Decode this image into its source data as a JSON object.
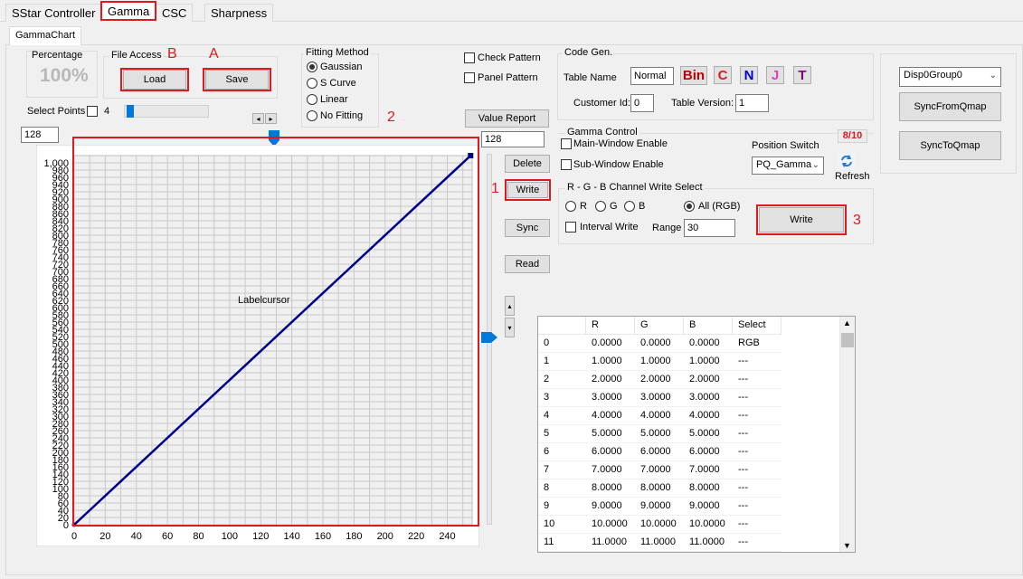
{
  "tabs": [
    "SStar Controller",
    "Gamma",
    "CSC",
    "Sharpness"
  ],
  "subtab": "GammaChart",
  "percentage": {
    "label": "Percentage",
    "value": "100%"
  },
  "file_access": {
    "label": "File Access",
    "load": "Load",
    "save": "Save"
  },
  "annotations": {
    "A": "A",
    "B": "B",
    "n1": "1",
    "n2": "2",
    "n3": "3"
  },
  "fitting": {
    "label": "Fitting Method",
    "options": [
      "Gaussian",
      "S Curve",
      "Linear",
      "No Fitting"
    ],
    "selected": "Gaussian"
  },
  "select_points": {
    "label": "Select Points",
    "value": "4",
    "checked": false
  },
  "x_value": "128",
  "y_value": "128",
  "check_pattern": "Check Pattern",
  "panel_pattern": "Panel Pattern",
  "buttons": {
    "value_report": "Value Report",
    "delete": "Delete",
    "write": "Write",
    "sync": "Sync",
    "read": "Read",
    "up": "▴",
    "down": "▾",
    "left": "◂",
    "right": "▸"
  },
  "code_gen": {
    "label": "Code Gen.",
    "table_name_label": "Table Name",
    "table_name": "Normal",
    "bin": "Bin",
    "c": "C",
    "n": "N",
    "j": "J",
    "t": "T",
    "customer_label": "Customer Id:",
    "customer_id": "0",
    "version_label": "Table Version:",
    "version": "1"
  },
  "gamma_control": {
    "label": "Gamma Control",
    "main_window": "Main-Window Enable",
    "sub_window": "Sub-Window Enable",
    "position_switch": "Position Switch",
    "position_value": "PQ_Gamma",
    "count": "8/10",
    "refresh": "Refresh"
  },
  "rgb_write": {
    "label": "R - G - B Channel Write Select",
    "r": "R",
    "g": "G",
    "b": "B",
    "all": "All (RGB)",
    "interval": "Interval Write",
    "range_label": "Range",
    "range": "30",
    "write": "Write"
  },
  "disp": {
    "group": "Disp0Group0",
    "sync_from": "SyncFromQmap",
    "sync_to": "SyncToQmap"
  },
  "chart_cursor_label": "Labelcursor",
  "colors": {
    "red": "#e0191e",
    "line": "#00008b",
    "accent": "#0078d7"
  },
  "table": {
    "headers": [
      "",
      "R",
      "G",
      "B",
      "Select"
    ],
    "rows": [
      [
        "0",
        "0.0000",
        "0.0000",
        "0.0000",
        "RGB"
      ],
      [
        "1",
        "1.0000",
        "1.0000",
        "1.0000",
        "---"
      ],
      [
        "2",
        "2.0000",
        "2.0000",
        "2.0000",
        "---"
      ],
      [
        "3",
        "3.0000",
        "3.0000",
        "3.0000",
        "---"
      ],
      [
        "4",
        "4.0000",
        "4.0000",
        "4.0000",
        "---"
      ],
      [
        "5",
        "5.0000",
        "5.0000",
        "5.0000",
        "---"
      ],
      [
        "6",
        "6.0000",
        "6.0000",
        "6.0000",
        "---"
      ],
      [
        "7",
        "7.0000",
        "7.0000",
        "7.0000",
        "---"
      ],
      [
        "8",
        "8.0000",
        "8.0000",
        "8.0000",
        "---"
      ],
      [
        "9",
        "9.0000",
        "9.0000",
        "9.0000",
        "---"
      ],
      [
        "10",
        "10.0000",
        "10.0000",
        "10.0000",
        "---"
      ],
      [
        "11",
        "11.0000",
        "11.0000",
        "11.0000",
        "---"
      ]
    ]
  },
  "chart_data": {
    "type": "line",
    "title": "",
    "xlabel": "",
    "ylabel": "",
    "xlim": [
      0,
      256
    ],
    "ylim": [
      0,
      1020
    ],
    "x_ticks": [
      0,
      20,
      40,
      60,
      80,
      100,
      120,
      140,
      160,
      180,
      200,
      220,
      240
    ],
    "y_ticks": [
      "0",
      "20",
      "40",
      "60",
      "80",
      "100",
      "120",
      "140",
      "160",
      "180",
      "200",
      "220",
      "240",
      "260",
      "280",
      "300",
      "320",
      "340",
      "360",
      "380",
      "400",
      "420",
      "440",
      "460",
      "480",
      "500",
      "520",
      "540",
      "560",
      "580",
      "600",
      "620",
      "640",
      "660",
      "680",
      "700",
      "720",
      "740",
      "760",
      "780",
      "800",
      "820",
      "840",
      "860",
      "880",
      "900",
      "920",
      "940",
      "960",
      "980",
      "1,000"
    ],
    "series": [
      {
        "x": [
          0,
          255
        ],
        "y": [
          0,
          1020
        ]
      }
    ],
    "grid": true
  }
}
